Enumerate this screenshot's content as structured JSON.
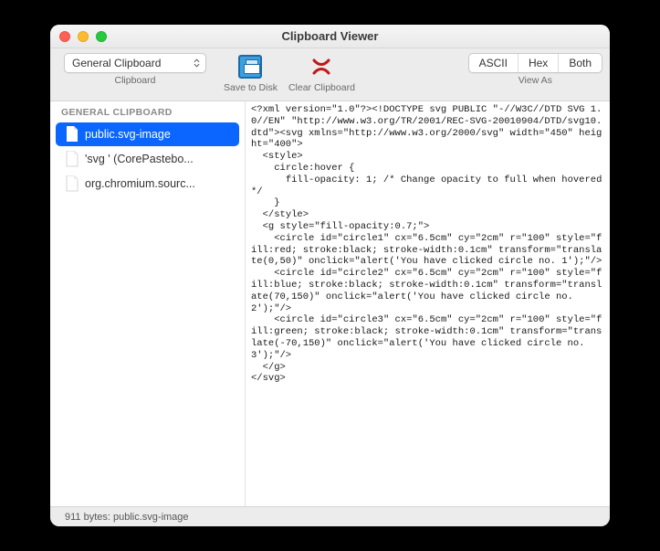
{
  "window": {
    "title": "Clipboard Viewer"
  },
  "toolbar": {
    "clipboard_select": "General Clipboard",
    "clipboard_label": "Clipboard",
    "save_label": "Save to Disk",
    "clear_label": "Clear Clipboard",
    "viewas_label": "View As",
    "seg": {
      "ascii": "ASCII",
      "hex": "Hex",
      "both": "Both"
    }
  },
  "sidebar": {
    "header": "GENERAL CLIPBOARD",
    "items": [
      {
        "label": "public.svg-image",
        "selected": true
      },
      {
        "label": "'svg ' (CorePastebo...",
        "selected": false
      },
      {
        "label": "org.chromium.sourc...",
        "selected": false
      }
    ]
  },
  "content": {
    "text": "<?xml version=\"1.0\"?><!DOCTYPE svg PUBLIC \"-//W3C//DTD SVG 1.0//EN\" \"http://www.w3.org/TR/2001/REC-SVG-20010904/DTD/svg10.dtd\"><svg xmlns=\"http://www.w3.org/2000/svg\" width=\"450\" height=\"400\">\n  <style>\n    circle:hover {\n      fill-opacity: 1; /* Change opacity to full when hovered */\n    }\n  </style>\n  <g style=\"fill-opacity:0.7;\">\n    <circle id=\"circle1\" cx=\"6.5cm\" cy=\"2cm\" r=\"100\" style=\"fill:red; stroke:black; stroke-width:0.1cm\" transform=\"translate(0,50)\" onclick=\"alert('You have clicked circle no. 1');\"/>\n    <circle id=\"circle2\" cx=\"6.5cm\" cy=\"2cm\" r=\"100\" style=\"fill:blue; stroke:black; stroke-width:0.1cm\" transform=\"translate(70,150)\" onclick=\"alert('You have clicked circle no. 2');\"/>\n    <circle id=\"circle3\" cx=\"6.5cm\" cy=\"2cm\" r=\"100\" style=\"fill:green; stroke:black; stroke-width:0.1cm\" transform=\"translate(-70,150)\" onclick=\"alert('You have clicked circle no. 3');\"/>\n  </g>\n</svg>"
  },
  "statusbar": {
    "text": "911 bytes: public.svg-image"
  }
}
